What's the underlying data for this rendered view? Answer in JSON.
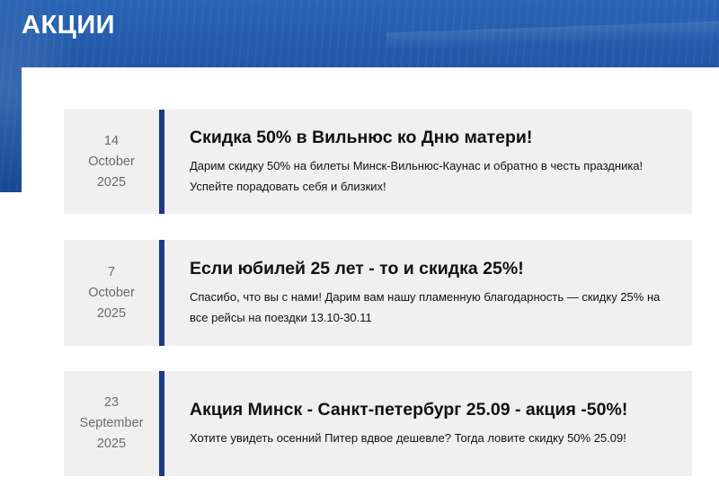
{
  "header": {
    "title": "АКЦИИ"
  },
  "promotions": [
    {
      "day": "14",
      "month": "October",
      "year": "2025",
      "title": "Скидка 50% в Вильнюс ко Дню матери!",
      "text": "Дарим скидку 50% на билеты Минск-Вильнюс-Каунас и обратно в честь праздника! Успейте порадовать себя и близких!"
    },
    {
      "day": "7",
      "month": "October",
      "year": "2025",
      "title": "Если юбилей 25 лет - то и скидка 25%!",
      "text": "Спасибо, что вы с нами! Дарим вам нашу пламенную благодарность — скидку 25% на все рейсы на поездки 13.10-30.11"
    },
    {
      "day": "23",
      "month": "September",
      "year": "2025",
      "title": "Акция Минск - Санкт-петербург 25.09 - акция -50%!",
      "text": "Хотите увидеть осенний Питер вдвое дешевле? Тогда ловите скидку 50% 25.09!"
    }
  ],
  "colors": {
    "banner": "#1f55a3",
    "accent_bar": "#1d3a86",
    "card_background": "#f0f0f0",
    "date_text": "#6b6b6b"
  }
}
